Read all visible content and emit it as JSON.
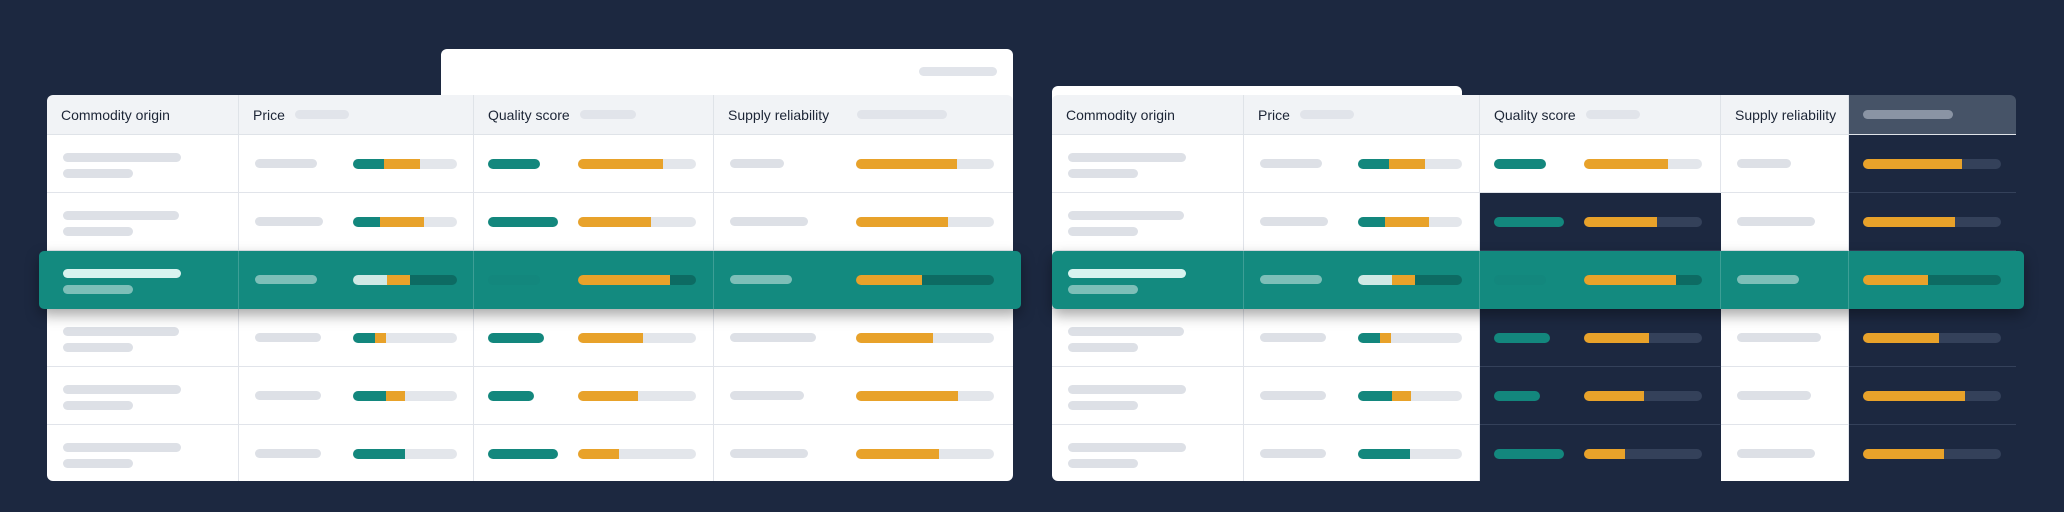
{
  "tables": [
    {
      "headers": [
        "Commodity origin",
        "Price",
        "Quality score",
        "Supply reliability"
      ],
      "rows": [
        {
          "price": {
            "teal": 0.3,
            "amber": 0.34
          },
          "quality": {
            "teal": 0.42,
            "amber": 0.72
          },
          "reliability": {
            "amber": 0.73
          }
        },
        {
          "price": {
            "teal": 0.26,
            "amber": 0.42
          },
          "quality": {
            "teal": 0.58,
            "amber": 0.62
          },
          "reliability": {
            "amber": 0.67
          }
        },
        {
          "price": {
            "light": 0.33,
            "amber": 0.22
          },
          "quality": {
            "light": 0.44,
            "amber": 0.78
          },
          "reliability": {
            "amber": 0.48
          }
        },
        {
          "price": {
            "teal": 0.21,
            "amber": 0.11
          },
          "quality": {
            "teal": 0.46,
            "amber": 0.55
          },
          "reliability": {
            "amber": 0.56
          }
        },
        {
          "price": {
            "teal": 0.32,
            "amber": 0.18
          },
          "quality": {
            "teal": 0.37,
            "amber": 0.51
          },
          "reliability": {
            "amber": 0.74
          }
        },
        {
          "price": {
            "teal": 0.5,
            "amber": 0.0
          },
          "quality": {
            "teal": 0.58,
            "amber": 0.35
          },
          "reliability": {
            "amber": 0.6
          }
        }
      ]
    },
    {
      "headers": [
        "Commodity origin",
        "Price",
        "Quality score",
        "Supply reliability"
      ],
      "rows": [
        {
          "price": {
            "teal": 0.3,
            "amber": 0.34
          },
          "quality": {
            "teal": 0.43,
            "amber": 0.71
          },
          "extra": {
            "amber": 0.72
          }
        },
        {
          "price": {
            "teal": 0.26,
            "amber": 0.42
          },
          "quality": {
            "teal": 0.59,
            "amber": 0.62
          },
          "extra": {
            "amber": 0.67
          }
        },
        {
          "price": {
            "light": 0.33,
            "amber": 0.22
          },
          "quality": {
            "light": 0.44,
            "amber": 0.78
          },
          "extra": {
            "amber": 0.47
          }
        },
        {
          "price": {
            "teal": 0.21,
            "amber": 0.11
          },
          "quality": {
            "teal": 0.48,
            "amber": 0.55
          },
          "extra": {
            "amber": 0.55
          }
        },
        {
          "price": {
            "teal": 0.33,
            "amber": 0.18
          },
          "quality": {
            "teal": 0.37,
            "amber": 0.51
          },
          "extra": {
            "amber": 0.74
          }
        },
        {
          "price": {
            "teal": 0.5,
            "amber": 0.0
          },
          "quality": {
            "teal": 0.6,
            "amber": 0.35
          },
          "extra": {
            "amber": 0.59
          }
        }
      ]
    }
  ],
  "highlighted_row_index": 2,
  "colors": {
    "background": "#1c2840",
    "highlight": "#138a7f",
    "teal": "#13877d",
    "amber": "#e8a22a"
  }
}
